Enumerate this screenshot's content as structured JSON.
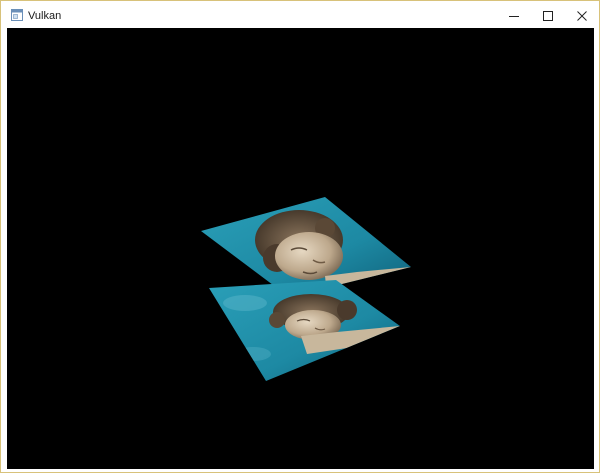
{
  "window": {
    "title": "Vulkan",
    "app_icon": "application-window-icon",
    "controls": {
      "minimize_icon": "minimize-icon",
      "maximize_icon": "maximize-icon",
      "close_icon": "close-icon"
    }
  },
  "viewport": {
    "background_color": "#000000",
    "scene": {
      "quads": [
        {
          "name": "textured-quad-back",
          "texture": "statue-head-on-teal-sky"
        },
        {
          "name": "textured-quad-front",
          "texture": "statue-head-on-teal-sky"
        }
      ]
    }
  },
  "colors": {
    "frame_border": "#d8c27a",
    "sky_teal": "#1f8fa8",
    "statue_stone": "#c9b8a0"
  }
}
